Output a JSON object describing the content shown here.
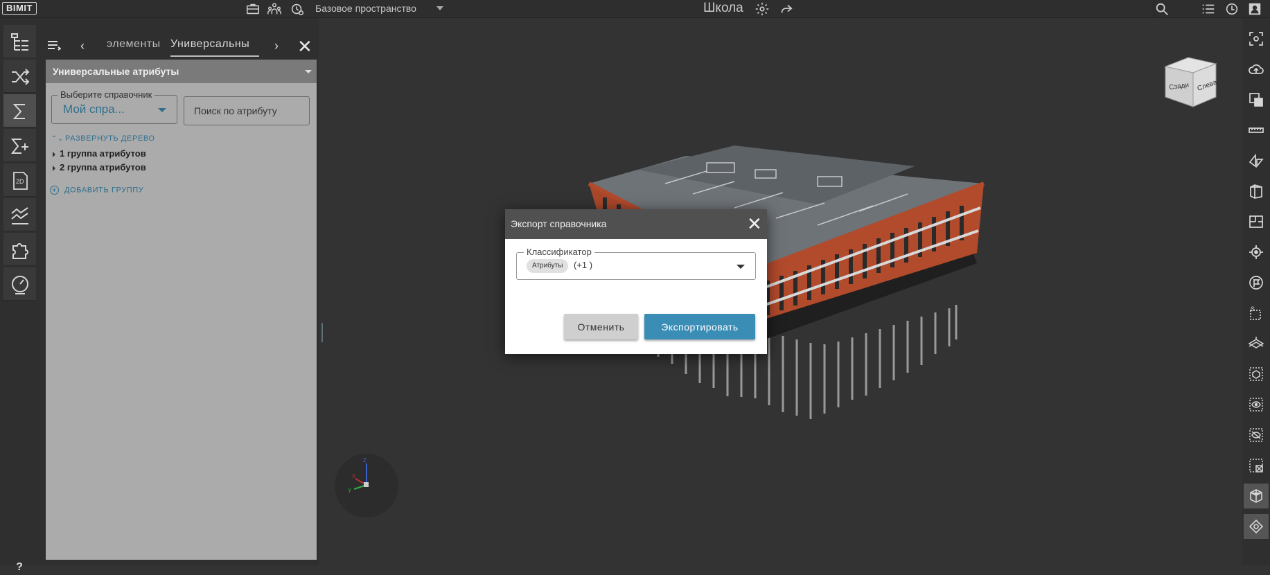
{
  "app": {
    "logo": "BIMIT",
    "space": "Базовое пространство",
    "project_title": "Школа"
  },
  "top_icons": [
    "briefcase-icon",
    "team-icon",
    "clock-settings-icon",
    "gear-icon",
    "share-icon",
    "search-icon",
    "list-icon",
    "sync-icon",
    "account-icon"
  ],
  "left_rail": {
    "items": [
      "model-tree-icon",
      "shuffle-icon",
      "sigma-icon",
      "sigma-plus-icon",
      "2d-icon",
      "chart-icon",
      "puzzle-icon",
      "gauge-icon"
    ],
    "active_index": 2,
    "label_2d": "2D",
    "help": "?"
  },
  "panel": {
    "tab_prev": "‹",
    "tabs": [
      "элементы",
      "Универсальны"
    ],
    "active_tab_index": 1,
    "tab_next": "›",
    "close": "✕",
    "header_title": "Универсальные атрибуты",
    "dict_select": {
      "label": "Выберите справочник",
      "value": "Мой спра..."
    },
    "search": {
      "placeholder": "Поиск по атрибуту",
      "value": ""
    },
    "expand_tree": "РАЗВЕРНУТЬ ДЕРЕВО",
    "groups": [
      "1 группа атрибутов",
      "2 группа атрибутов"
    ],
    "add_group": "ДОБАВИТЬ ГРУППУ"
  },
  "viewport": {
    "navcube_faces": [
      "Сзади",
      "Слева"
    ],
    "axes": [
      "Z",
      "X",
      "Y"
    ]
  },
  "right_rail": [
    "fit-icon",
    "cloud-icon",
    "zoom-selection-icon",
    "ruler-icon",
    "section-plane-icon",
    "section-box-icon",
    "floor-plan-icon",
    "location-icon",
    "flag-icon",
    "markup-icon",
    "grid-icon",
    "isolate-icon",
    "show-icon",
    "hide-icon",
    "remove-icon",
    "cube-icon",
    "navigation-icon"
  ],
  "dialog": {
    "title": "Экспорт справочника",
    "close": "✕",
    "classifier_label": "Классификатор",
    "chip": "Атрибуты",
    "more": "(+1 )",
    "cancel": "Отменить",
    "export": "Экспортировать"
  },
  "colors": {
    "accent": "#3a8db5",
    "link": "#2f6f8d",
    "brick": "#b24a2c"
  }
}
